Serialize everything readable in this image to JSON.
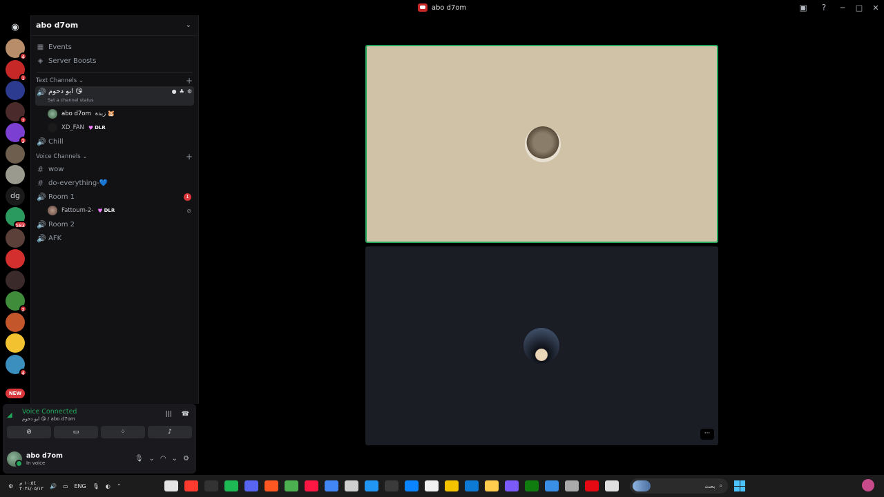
{
  "window": {
    "title": "abo d7om"
  },
  "rail": {
    "new_label": "NEW",
    "servers": [
      {
        "badge": "4",
        "color": "#b88e6a"
      },
      {
        "badge": "1",
        "color": "#c62828"
      },
      {
        "badge": "",
        "color": "#2c3a8f"
      },
      {
        "badge": "7",
        "color": "#4a2a2a"
      },
      {
        "badge": "3",
        "color": "#7b3fd1"
      },
      {
        "badge": "",
        "color": "#6e5e4d"
      },
      {
        "badge": "",
        "color": "#9a9a8e"
      },
      {
        "badge": "",
        "color": "#1a1a1a",
        "text": "dg"
      },
      {
        "badge": "583",
        "color": "#2b9a5e"
      },
      {
        "badge": "",
        "color": "#5a4038"
      },
      {
        "badge": "",
        "color": "#d32f2f"
      },
      {
        "badge": "",
        "color": "#3a2a2a"
      },
      {
        "badge": "2",
        "color": "#3f8c3a"
      },
      {
        "badge": "",
        "color": "#c4562c"
      },
      {
        "badge": "",
        "color": "#f2c230"
      },
      {
        "badge": "4",
        "color": "#3a8fbf"
      }
    ]
  },
  "server": {
    "name": "abo d7om",
    "items": [
      {
        "label": "Events"
      },
      {
        "label": "Server Boosts"
      }
    ],
    "text_category": "Text Channels",
    "voice_category": "Voice Channels",
    "active_channel": {
      "name": "ابو دحوم 😘",
      "status": "Set a channel status"
    },
    "active_users": [
      {
        "name": "abo d7om",
        "extra": "زبدة 🐹"
      },
      {
        "name": "XD_FAN",
        "tag": "DLR"
      }
    ],
    "channels_a": [
      {
        "name": "Chill"
      }
    ],
    "channels_b": [
      {
        "name": "wow"
      },
      {
        "name": "do-everything-💙"
      }
    ],
    "room1": {
      "name": "Room 1",
      "badge": "1",
      "user": "Fattoum-2-",
      "user_tag": "DLR"
    },
    "channels_c": [
      {
        "name": "Room 2"
      },
      {
        "name": "AFK"
      }
    ]
  },
  "voice": {
    "status": "Voice Connected",
    "sub": "ابو دحوم 😘 / abo d7om"
  },
  "user": {
    "name": "abo d7om",
    "sub": "In voice"
  },
  "taskbar": {
    "lang": "ENG",
    "time": "١٠:٥٤ م",
    "date": "٢٠٢٤/٠٥/١٢",
    "search": "بحث",
    "apps": [
      "#e4e4e4",
      "#ff3b30",
      "#333",
      "#1db954",
      "#5865f2",
      "#ff5722",
      "#4caf50",
      "#ff1744",
      "#4285f4",
      "#cfcfcf",
      "#2196f3",
      "#3a3a3a",
      "#0a84ff",
      "#f1f1f1",
      "#f5c400",
      "#0d7ad6",
      "#ffcc4d",
      "#7a5af8",
      "#107c10",
      "#3a8ee6",
      "#aaaaaa",
      "#e50914",
      "#e0e0e0"
    ]
  }
}
